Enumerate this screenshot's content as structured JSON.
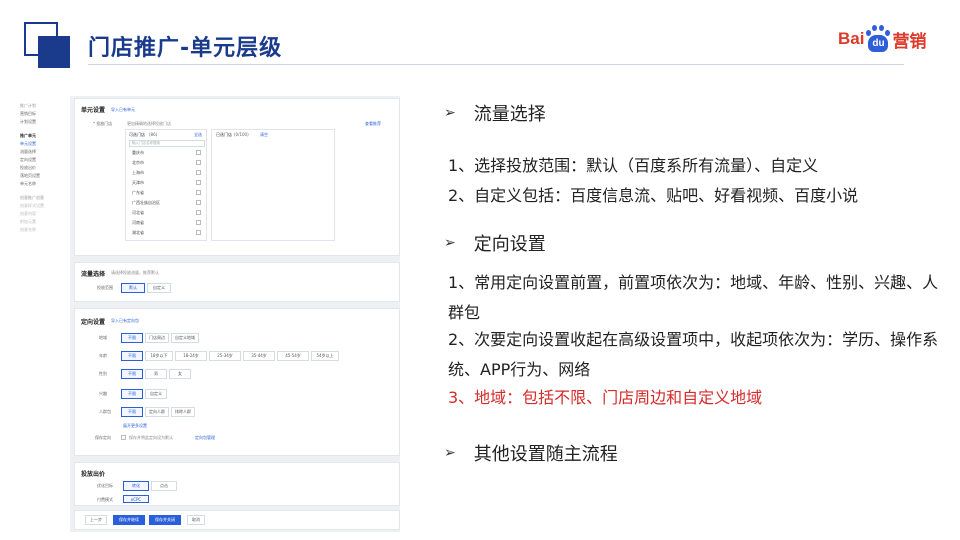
{
  "slide": {
    "title": "门店推广-单元层级",
    "brand": {
      "bai": "Bai",
      "du": "du",
      "ying": "营销"
    }
  },
  "ui": {
    "nav": {
      "top": [
        "推广计划",
        "营销目标",
        "计划设置"
      ],
      "unit_group": "推广单元",
      "unit_items": [
        "单元设置",
        "流量选择",
        "定向设置",
        "投放出价",
        "落地页设置",
        "单元名称"
      ],
      "other_group": "创意推广创意",
      "other_items": [
        "创意样式设置",
        "创意内容",
        "附加元素",
        "创意名称"
      ]
    },
    "unit_settings": {
      "title": "单元设置",
      "link": "导入已有单元",
      "store_label": "* 投放门店",
      "store_desc": "更加精确地选择投放门店",
      "store_link": "查看推荐",
      "selectable_label": "可选门店",
      "selectable_count": "(86)",
      "select_all": "全选",
      "search_placeholder": "输入门店名称搜索",
      "selected_label": "已选门店",
      "selected_count": "(0/100)",
      "clear_label": "清空",
      "regions": [
        "重庆市",
        "北京市",
        "上海市",
        "天津市",
        "广东省",
        "广西壮族自治区",
        "河北省",
        "河南省",
        "湖北省"
      ]
    },
    "traffic": {
      "title": "流量选择",
      "desc": "请选择投放流量，推荐默认",
      "scope_label": "投放范围",
      "options": [
        "默认",
        "自定义"
      ]
    },
    "targeting": {
      "title": "定向设置",
      "link": "导入已有定向包",
      "rows": [
        {
          "label": "地域",
          "options": [
            "不限",
            "门店周边",
            "自定义地域"
          ]
        },
        {
          "label": "年龄",
          "options": [
            "不限",
            "18岁以下",
            "18-24岁",
            "25-34岁",
            "35-44岁",
            "45-54岁",
            "54岁以上"
          ]
        },
        {
          "label": "性别",
          "options": [
            "不限",
            "男",
            "女"
          ]
        },
        {
          "label": "兴趣",
          "options": [
            "不限",
            "自定义"
          ]
        },
        {
          "label": "人群包",
          "options": [
            "不限",
            "定向人群",
            "排除人群"
          ]
        }
      ],
      "expand_link": "展开更多设置",
      "save_label": "保存定向",
      "save_desc": "保存并将此定向设为默认",
      "save_link": "定向包管理"
    },
    "bidding": {
      "title": "投放出价",
      "goal_label": "优化目标",
      "goal_options": [
        "转化",
        "点击"
      ],
      "mode_label": "付费模式",
      "mode_options": [
        "oCPC"
      ]
    },
    "footer": {
      "prev": "上一步",
      "save_next": "保存并继续",
      "save_close": "保存并关闭",
      "cancel": "取消"
    }
  },
  "bullets": {
    "h1": "流量选择",
    "p1": "1、选择投放范围：默认（百度系所有流量）、自定义",
    "p2": "2、自定义包括：百度信息流、贴吧、好看视频、百度小说",
    "h2": "定向设置",
    "p3": "1、常用定向设置前置，前置项依次为：地域、年龄、性别、兴趣、人群包",
    "p4": "2、次要定向设置收起在高级设置项中，收起项依次为：学历、操作系统、APP行为、网络",
    "p5": "3、地域：包括不限、门店周边和自定义地域",
    "h3": "其他设置随主流程",
    "arrow": "➢"
  }
}
